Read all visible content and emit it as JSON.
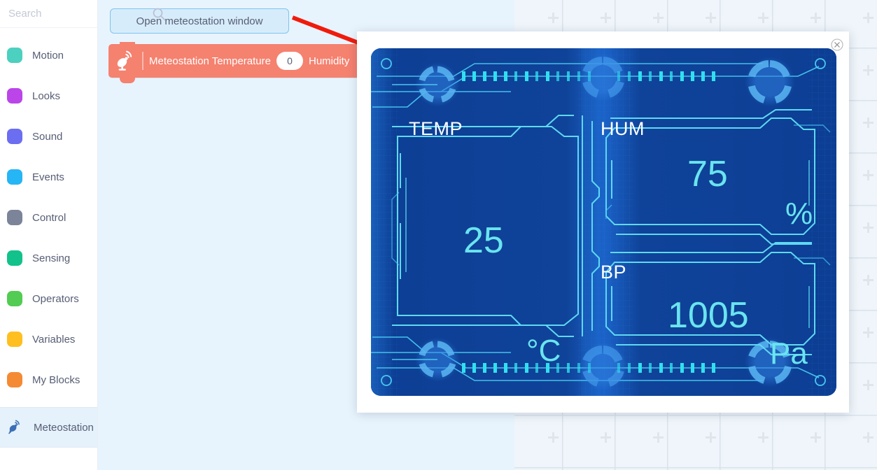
{
  "palette": {
    "search": {
      "placeholder": "Search",
      "value": "",
      "icon": "search-icon"
    },
    "categories": [
      {
        "label": "Motion",
        "color": "#4cd0c0"
      },
      {
        "label": "Looks",
        "color": "#bb45e8"
      },
      {
        "label": "Sound",
        "color": "#6b6ef0"
      },
      {
        "label": "Events",
        "color": "#26b5f5"
      },
      {
        "label": "Control",
        "color": "#7b8499"
      },
      {
        "label": "Sensing",
        "color": "#12c28a"
      },
      {
        "label": "Operators",
        "color": "#52cc52"
      },
      {
        "label": "Variables",
        "color": "#ffbf20"
      },
      {
        "label": "My Blocks",
        "color": "#f58a34"
      }
    ],
    "extension": {
      "label": "Meteostation",
      "icon": "satellite-dish-icon",
      "color": "#3a6fb5",
      "active": true
    }
  },
  "workspace": {
    "open_window_button": {
      "label": "Open meteostation window"
    },
    "block": {
      "icon": "satellite-dish-icon",
      "label_temperature": "Meteostation Temperature",
      "value": "0",
      "label_humidity": "Humidity",
      "color": "#f5816f"
    },
    "annotation": {
      "type": "red-arrow",
      "color": "#f01b0c"
    }
  },
  "modal": {
    "close_label": "×",
    "hud": {
      "background": "#0f4296",
      "accent": "#6ae4ee",
      "panels": [
        {
          "key": "temp",
          "label": "TEMP",
          "value": "25",
          "unit": "°C"
        },
        {
          "key": "hum",
          "label": "HUM",
          "value": "75",
          "unit": "%"
        },
        {
          "key": "bp",
          "label": "BP",
          "value": "1005",
          "unit": "Pa"
        }
      ]
    }
  }
}
